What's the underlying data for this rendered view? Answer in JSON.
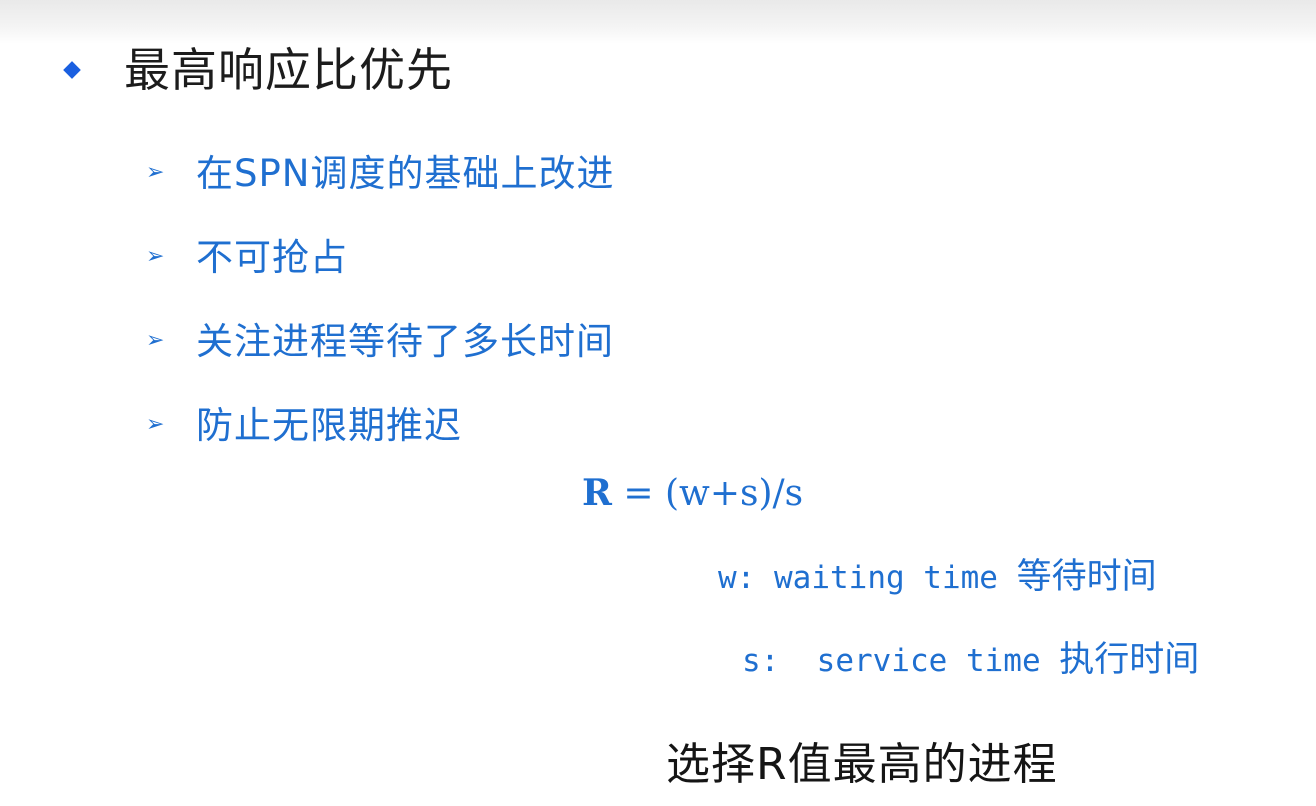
{
  "slide": {
    "title": "最高响应比优先",
    "sub_items": [
      {
        "text": "在SPN调度的基础上改进"
      },
      {
        "text": "不可抢占"
      },
      {
        "text": "关注进程等待了多长时间"
      },
      {
        "text": "防止无限期推迟"
      }
    ],
    "formula": {
      "lhs": "R",
      "rhs": " = (w+s)/s"
    },
    "definitions": [
      {
        "symbol": "w:",
        "term": "waiting time",
        "cn": "等待时间"
      },
      {
        "symbol": "s:",
        "term": "service time",
        "cn": "执行时间"
      }
    ],
    "conclusion": "选择R值最高的进程"
  },
  "colors": {
    "accent": "#1f6fd0",
    "bullet": "#1a5fe0",
    "text": "#1c1c1c"
  },
  "icons": {
    "main_bullet": "diamond-icon",
    "sub_bullet": "arrowhead-icon"
  }
}
